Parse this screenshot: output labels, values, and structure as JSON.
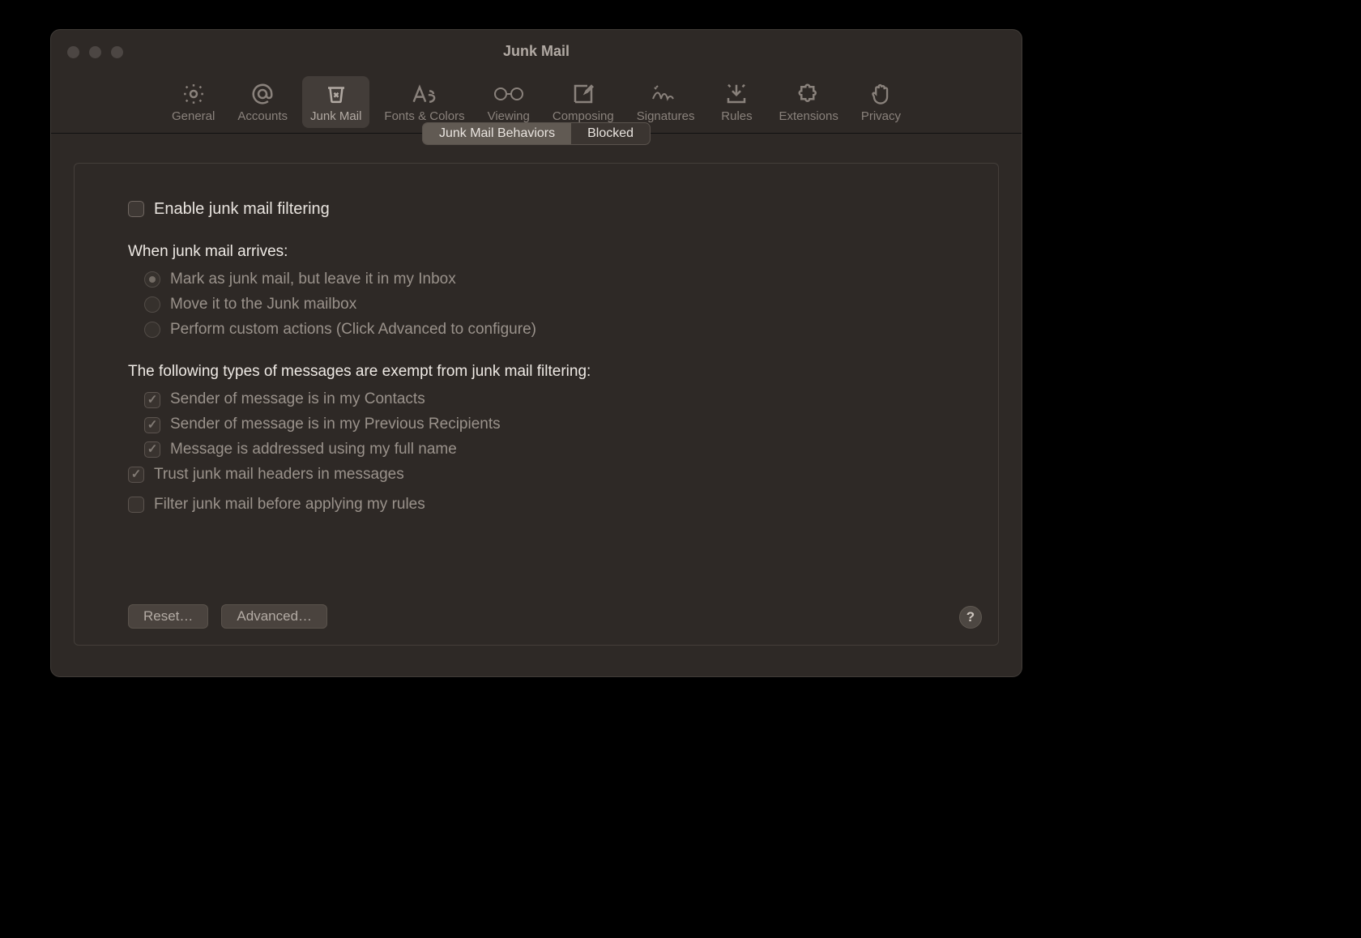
{
  "window": {
    "title": "Junk Mail"
  },
  "toolbar": {
    "tabs": [
      {
        "label": "General"
      },
      {
        "label": "Accounts"
      },
      {
        "label": "Junk Mail"
      },
      {
        "label": "Fonts & Colors"
      },
      {
        "label": "Viewing"
      },
      {
        "label": "Composing"
      },
      {
        "label": "Signatures"
      },
      {
        "label": "Rules"
      },
      {
        "label": "Extensions"
      },
      {
        "label": "Privacy"
      }
    ],
    "active_index": 2
  },
  "segments": {
    "items": [
      "Junk Mail Behaviors",
      "Blocked"
    ],
    "active_index": 0
  },
  "enable": {
    "label": "Enable junk mail filtering",
    "checked": false
  },
  "when_arrives": {
    "heading": "When junk mail arrives:",
    "options": [
      "Mark as junk mail, but leave it in my Inbox",
      "Move it to the Junk mailbox",
      "Perform custom actions (Click Advanced to configure)"
    ],
    "selected_index": 0
  },
  "exempt": {
    "heading": "The following types of messages are exempt from junk mail filtering:",
    "items": [
      {
        "label": "Sender of message is in my Contacts",
        "checked": true
      },
      {
        "label": "Sender of message is in my Previous Recipients",
        "checked": true
      },
      {
        "label": "Message is addressed using my full name",
        "checked": true
      }
    ]
  },
  "trust": {
    "label": "Trust junk mail headers in messages",
    "checked": true
  },
  "filter_before": {
    "label": "Filter junk mail before applying my rules",
    "checked": false
  },
  "buttons": {
    "reset": "Reset…",
    "advanced": "Advanced…"
  },
  "help": {
    "label": "?"
  }
}
